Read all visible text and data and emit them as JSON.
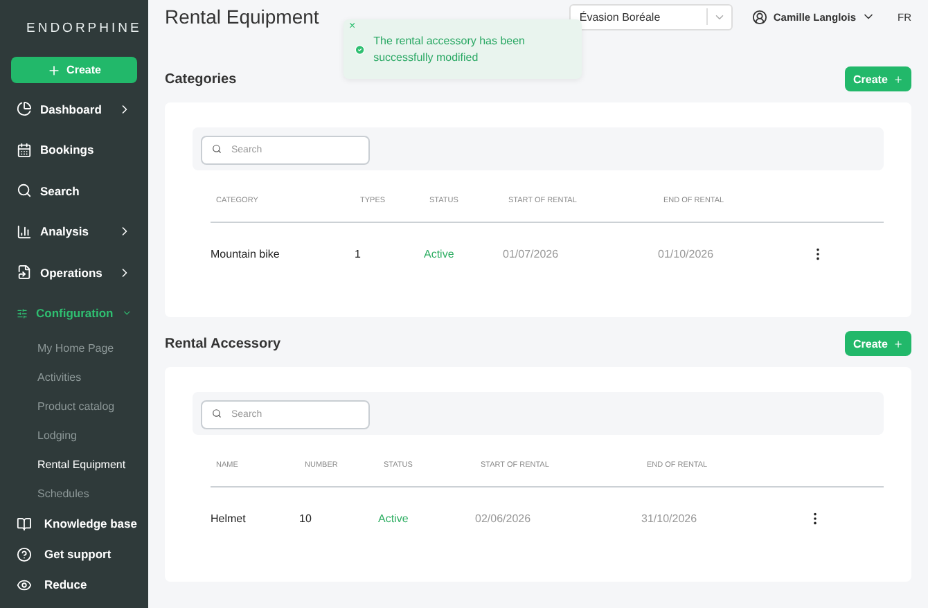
{
  "sidebar": {
    "logo": "ENDORPHINE",
    "create_button": "Create",
    "nav": [
      {
        "label": "Dashboard",
        "selected": false,
        "expanded": false
      },
      {
        "label": "Bookings",
        "selected": false
      },
      {
        "label": "Search",
        "selected": false
      },
      {
        "label": "Analysis",
        "selected": false,
        "expanded": false
      },
      {
        "label": "Operations",
        "selected": false,
        "expanded": false
      },
      {
        "label": "Configuration",
        "selected": true,
        "expanded": true,
        "children": [
          {
            "label": "My Home Page",
            "selected": false
          },
          {
            "label": "Activities",
            "selected": false
          },
          {
            "label": "Product catalog",
            "selected": false
          },
          {
            "label": "Lodging",
            "selected": false
          },
          {
            "label": "Rental Equipment",
            "selected": true
          },
          {
            "label": "Schedules",
            "selected": false
          }
        ]
      }
    ],
    "footer": [
      "Knowledge base",
      "Get support",
      "Reduce"
    ]
  },
  "header": {
    "title": "Rental Equipment",
    "company_select": "Évasion Boréale",
    "user": "Camille Langlois",
    "language": "FR"
  },
  "toast": {
    "message": "The rental accessory has been successfully modified",
    "close": "×"
  },
  "sections": [
    {
      "title": "Categories",
      "create_button": "Create",
      "search_placeholder": "Search",
      "columns": [
        {
          "label": "CATEGORY",
          "kind": "name"
        },
        {
          "label": "TYPES",
          "kind": "number"
        },
        {
          "label": "STATUS",
          "kind": "status"
        },
        {
          "label": "START OF RENTAL",
          "kind": "date"
        },
        {
          "label": "END OF RENTAL",
          "kind": "date"
        }
      ],
      "rows": [
        [
          "Mountain bike",
          "1",
          "Active",
          "01/07/2026",
          "01/10/2026"
        ]
      ]
    },
    {
      "title": "Rental Accessory",
      "create_button": "Create",
      "search_placeholder": "Search",
      "columns": [
        {
          "label": "NAME",
          "kind": "name"
        },
        {
          "label": "NUMBER",
          "kind": "number"
        },
        {
          "label": "STATUS",
          "kind": "status"
        },
        {
          "label": "START OF RENTAL",
          "kind": "date"
        },
        {
          "label": "END OF RENTAL",
          "kind": "date"
        }
      ],
      "rows": [
        [
          "Helmet",
          "10",
          "Active",
          "02/06/2026",
          "31/10/2026"
        ]
      ]
    }
  ]
}
